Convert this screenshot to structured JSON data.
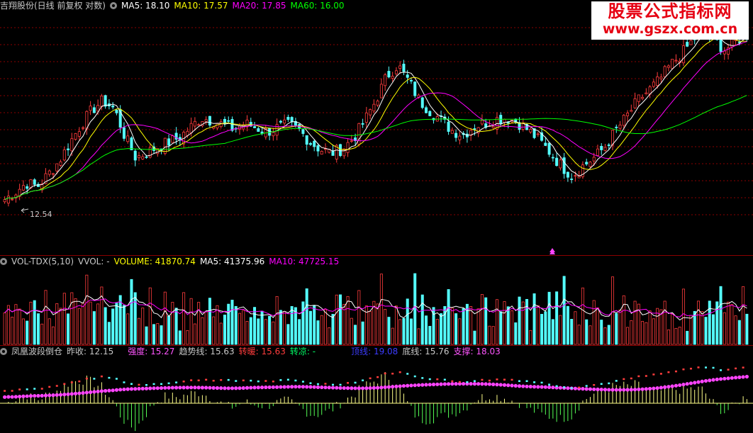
{
  "main_panel": {
    "title": "吉翔股份(日线 前复权 对数)",
    "ma5_label": "MA5: 18.10",
    "ma10_label": "MA10: 17.57",
    "ma20_label": "MA20: 17.85",
    "ma60_label": "MA60: 16.00",
    "low_marker": "12.54"
  },
  "volume_panel": {
    "title": "VOL-TDX(5,10)",
    "vvol": "VVOL: -",
    "volume": "VOLUME: 41870.74",
    "ma5": "MA5: 41375.96",
    "ma10": "MA10: 47725.15"
  },
  "indicator_panel": {
    "title": "凤凰波段倒仓",
    "prev_close": "昨收: 12.15",
    "strength": "强度: 15.27",
    "trend": "趋势线: 15.63",
    "warm": "转暖: 15.63",
    "cool": "转凉: -",
    "top": "顶线: 19.08",
    "bottom": "底线: 15.76",
    "support": "支撑: 18.03"
  },
  "watermark": {
    "line1": "股票公式指标网",
    "line2": "www.gszx.com.cn"
  },
  "colors": {
    "up": "#ff3c3c",
    "down": "#54ffff",
    "ma5": "#ffffff",
    "ma10": "#ffff00",
    "ma20": "#ff00ff",
    "ma60": "#00ff00",
    "grid": "#8b0000"
  },
  "chart_data": {
    "type": "candlestick",
    "scale": "log",
    "price_min_labeled": 12.54,
    "close_trend": [
      13.2,
      13.6,
      14.1,
      13.9,
      14.6,
      15.4,
      16.6,
      17.8,
      18.9,
      19.6,
      19.0,
      17.0,
      15.6,
      15.9,
      16.3,
      16.6,
      16.9,
      17.6,
      18.3,
      18.1,
      17.8,
      17.5,
      17.9,
      17.6,
      17.3,
      17.6,
      17.8,
      17.4,
      16.6,
      16.1,
      15.9,
      16.2,
      16.9,
      18.1,
      19.6,
      21.6,
      22.6,
      21.2,
      19.6,
      18.8,
      18.1,
      17.4,
      17.1,
      17.7,
      17.9,
      18.2,
      18.3,
      18.0,
      17.4,
      16.7,
      15.9,
      15.1,
      14.5,
      15.1,
      15.6,
      16.3,
      17.4,
      18.4,
      19.6,
      20.4,
      21.3,
      22.6,
      23.6,
      24.9,
      26.0,
      25.0,
      24.0,
      24.9,
      25.8
    ],
    "ma5": 18.1,
    "ma10": 17.57,
    "ma20": 17.85,
    "ma60": 16.0
  }
}
